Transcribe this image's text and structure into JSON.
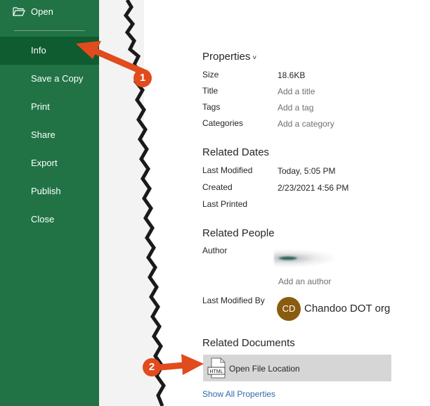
{
  "nav": {
    "open": "Open",
    "items": [
      {
        "label": "Info"
      },
      {
        "label": "Save a Copy"
      },
      {
        "label": "Print"
      },
      {
        "label": "Share"
      },
      {
        "label": "Export"
      },
      {
        "label": "Publish"
      },
      {
        "label": "Close"
      }
    ]
  },
  "properties": {
    "heading": "Properties",
    "chevron": "˅",
    "size_label": "Size",
    "size_value": "18.6KB",
    "title_label": "Title",
    "title_value": "Add a title",
    "tags_label": "Tags",
    "tags_value": "Add a tag",
    "categories_label": "Categories",
    "categories_value": "Add a category"
  },
  "related_dates": {
    "heading": "Related Dates",
    "last_modified_label": "Last Modified",
    "last_modified_value": "Today, 5:05 PM",
    "created_label": "Created",
    "created_value": "2/23/2021 4:56 PM",
    "last_printed_label": "Last Printed"
  },
  "related_people": {
    "heading": "Related People",
    "author_label": "Author",
    "add_author": "Add an author",
    "last_modified_by_label": "Last Modified By",
    "modifier_initials": "CD",
    "modifier_name": "Chandoo DOT org"
  },
  "related_documents": {
    "heading": "Related Documents",
    "open_location": "Open File Location",
    "file_icon_text": "HTML"
  },
  "show_all": "Show All Properties",
  "callouts": {
    "one": "1",
    "two": "2"
  },
  "colors": {
    "nav": "#217346",
    "nav_active": "#0e5c2f",
    "callout": "#e14b1d",
    "link": "#2b6cb0"
  }
}
